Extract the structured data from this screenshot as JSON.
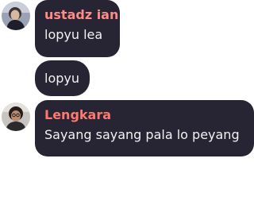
{
  "colors": {
    "bubble_bg": "#272433",
    "message_text": "#f2f2f2",
    "name_ustadz": "#ff8a86",
    "name_lengkara": "#ff7a6e",
    "background": "#ffffff"
  },
  "messages": [
    {
      "sender": "ustadz ian",
      "avatar": "user-avatar-ustadz-ian",
      "lines": [
        "lopyu lea",
        "lopyu"
      ]
    },
    {
      "sender": "Lengkara",
      "avatar": "user-avatar-lengkara",
      "lines": [
        "Sayang sayang pala lo peyang"
      ]
    }
  ]
}
